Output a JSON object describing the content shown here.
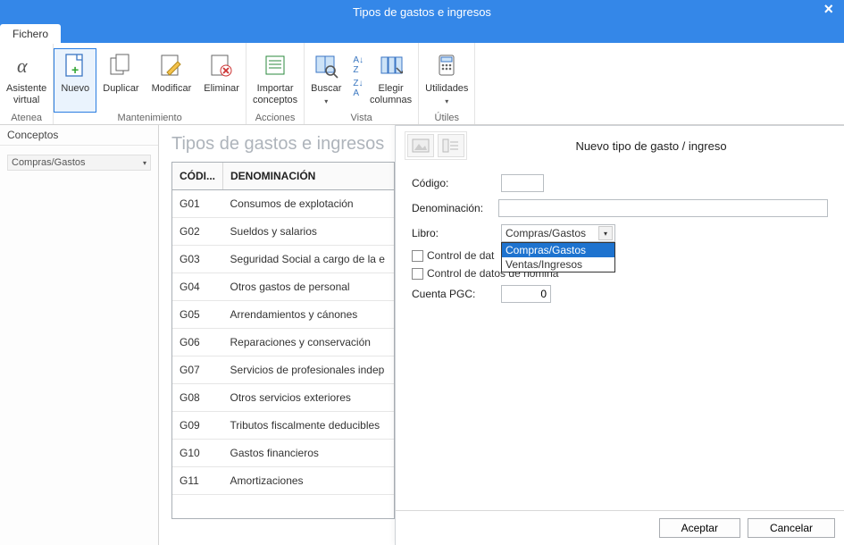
{
  "window": {
    "title": "Tipos de gastos e ingresos",
    "close_glyph": "×"
  },
  "tabs": {
    "file": "Fichero"
  },
  "ribbon": {
    "atenea": {
      "label": "Atenea",
      "btn_asistente_l1": "Asistente",
      "btn_asistente_l2": "virtual"
    },
    "mantenimiento": {
      "label": "Mantenimiento",
      "nuevo": "Nuevo",
      "duplicar": "Duplicar",
      "modificar": "Modificar",
      "eliminar": "Eliminar"
    },
    "acciones": {
      "label": "Acciones",
      "importar_l1": "Importar",
      "importar_l2": "conceptos"
    },
    "vista": {
      "label": "Vista",
      "buscar": "Buscar",
      "elegir_l1": "Elegir",
      "elegir_l2": "columnas"
    },
    "utiles": {
      "label": "Útiles",
      "utilidades": "Utilidades"
    }
  },
  "sidebar": {
    "header": "Conceptos",
    "category_selected": "Compras/Gastos"
  },
  "content": {
    "title": "Tipos de gastos e ingresos",
    "columns": {
      "code": "CÓDI...",
      "name": "DENOMINACIÓN"
    },
    "rows": [
      {
        "code": "G01",
        "name": "Consumos de explotación"
      },
      {
        "code": "G02",
        "name": "Sueldos y salarios"
      },
      {
        "code": "G03",
        "name": "Seguridad Social a cargo de la e"
      },
      {
        "code": "G04",
        "name": "Otros gastos de personal"
      },
      {
        "code": "G05",
        "name": "Arrendamientos y cánones"
      },
      {
        "code": "G06",
        "name": "Reparaciones y conservación"
      },
      {
        "code": "G07",
        "name": "Servicios de profesionales indep"
      },
      {
        "code": "G08",
        "name": "Otros servicios exteriores"
      },
      {
        "code": "G09",
        "name": "Tributos fiscalmente deducibles"
      },
      {
        "code": "G10",
        "name": "Gastos financieros"
      },
      {
        "code": "G11",
        "name": "Amortizaciones"
      }
    ]
  },
  "dialog": {
    "title": "Nuevo tipo de gasto / ingreso",
    "labels": {
      "codigo": "Código:",
      "denominacion": "Denominación:",
      "libro": "Libro:",
      "cuenta_pgc": "Cuenta PGC:"
    },
    "checkboxes": {
      "datos_irpf": "Control de dat",
      "datos_nomina": "Control de datos de nómina"
    },
    "libro_selected": "Compras/Gastos",
    "libro_options": {
      "opt1": "Compras/Gastos",
      "opt2": "Ventas/Ingresos"
    },
    "cuenta_value": "0",
    "codigo_value": "",
    "denominacion_value": "",
    "buttons": {
      "accept": "Aceptar",
      "cancel": "Cancelar"
    }
  }
}
